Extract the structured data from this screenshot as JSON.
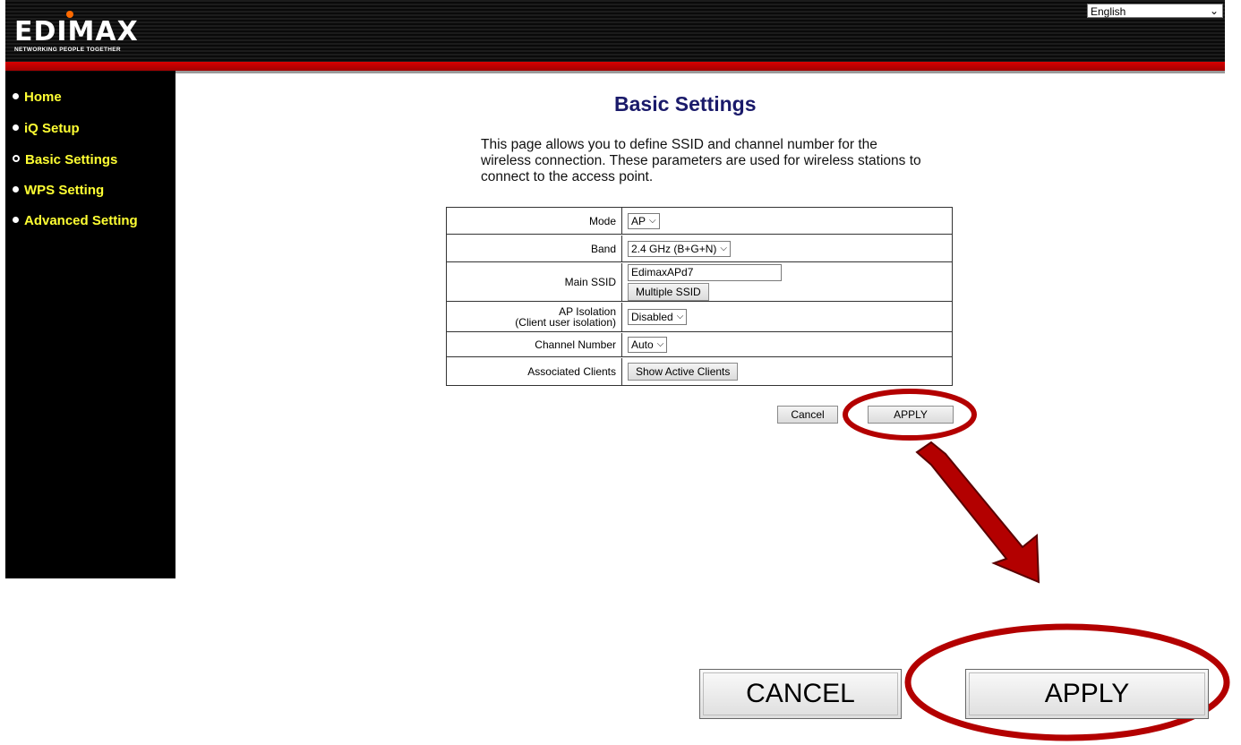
{
  "header": {
    "brand": "EDIMAX",
    "tagline": "NETWORKING PEOPLE TOGETHER",
    "language": "English"
  },
  "sidebar": {
    "items": [
      {
        "label": "Home",
        "active": false
      },
      {
        "label": "iQ Setup",
        "active": false
      },
      {
        "label": "Basic Settings",
        "active": true
      },
      {
        "label": "WPS Setting",
        "active": false
      },
      {
        "label": "Advanced Setting",
        "active": false
      }
    ]
  },
  "main": {
    "title": "Basic Settings",
    "description": "This page allows you to define SSID and channel number for the wireless connection. These parameters are used for wireless stations to connect to the access point.",
    "form": {
      "mode": {
        "label": "Mode",
        "value": "AP"
      },
      "band": {
        "label": "Band",
        "value": "2.4 GHz (B+G+N)"
      },
      "main_ssid": {
        "label": "Main SSID",
        "value": "EdimaxAPd7",
        "button": "Multiple SSID"
      },
      "ap_isolation": {
        "label_line1": "AP Isolation",
        "label_line2": "(Client user isolation)",
        "value": "Disabled"
      },
      "channel": {
        "label": "Channel Number",
        "value": "Auto"
      },
      "clients": {
        "label": "Associated Clients",
        "button": "Show Active Clients"
      }
    },
    "actions": {
      "cancel": "Cancel",
      "apply": "APPLY"
    }
  },
  "zoom": {
    "cancel": "CANCEL",
    "apply": "APPLY"
  },
  "colors": {
    "accent_red": "#b30000",
    "nav_yellow": "#ffff33",
    "title_navy": "#1a1a6a"
  }
}
